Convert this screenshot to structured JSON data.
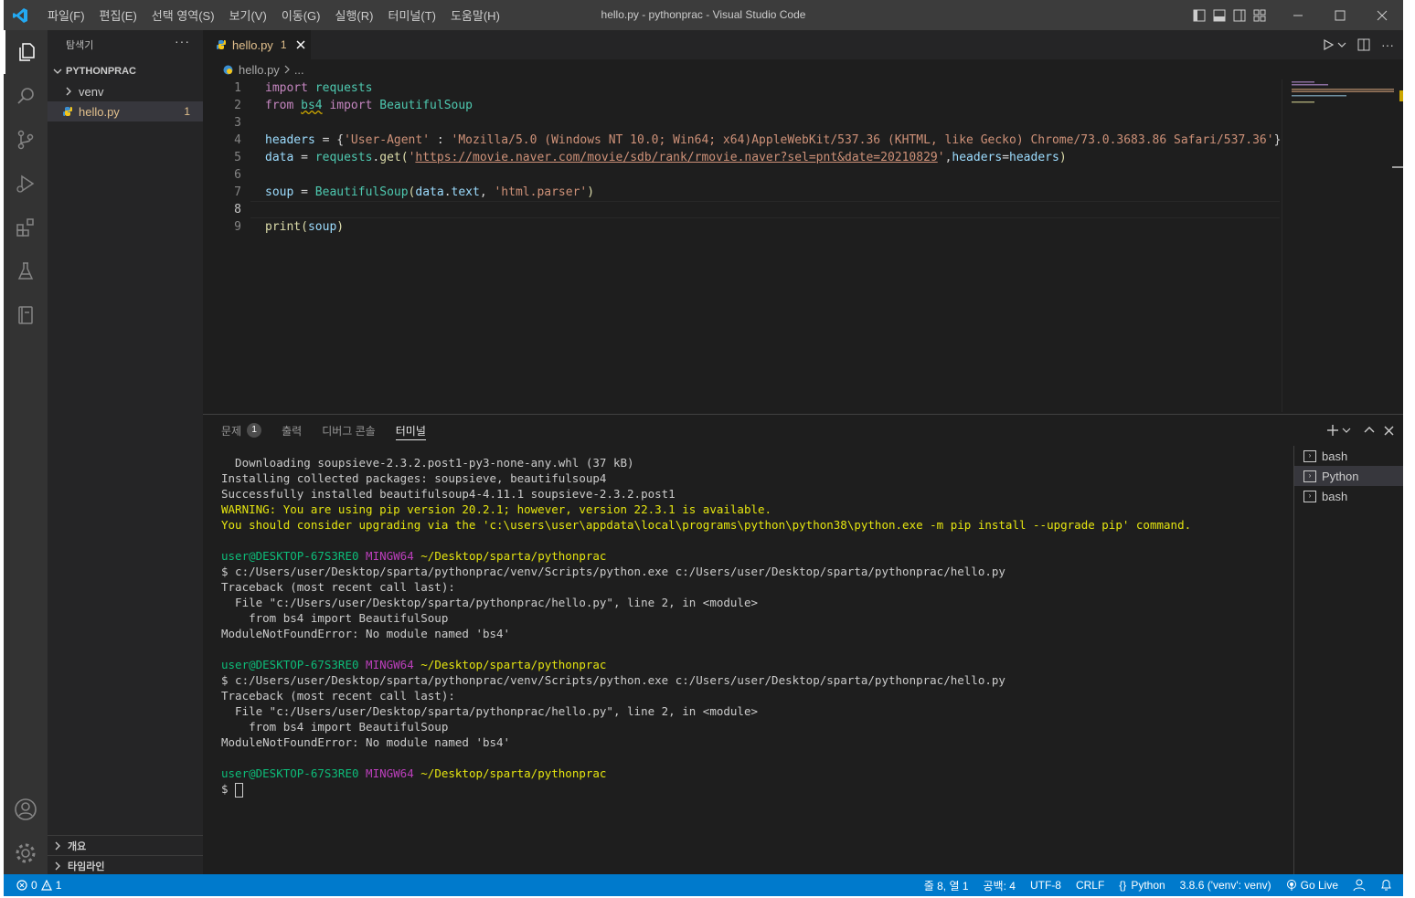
{
  "colors": {
    "accent": "#007acc",
    "editor_bg": "#1e1e1e",
    "sidebar_bg": "#252526",
    "activity_bg": "#333333",
    "title_bg": "#3c3c3c"
  },
  "menu": [
    "파일(F)",
    "편집(E)",
    "선택 영역(S)",
    "보기(V)",
    "이동(G)",
    "실행(R)",
    "터미널(T)",
    "도움말(H)"
  ],
  "window_title": "hello.py - pythonprac - Visual Studio Code",
  "sidebar": {
    "title": "탐색기",
    "more": "···",
    "folder": "PYTHONPRAC",
    "items": [
      {
        "label": "venv",
        "type": "folder"
      },
      {
        "label": "hello.py",
        "type": "file",
        "badge": "1"
      }
    ],
    "outline": "개요",
    "timeline": "타임라인"
  },
  "tab": {
    "label": "hello.py",
    "badge": "1"
  },
  "breadcrumb": {
    "file": "hello.py",
    "rest": "..."
  },
  "code": {
    "line_numbers": [
      "1",
      "2",
      "3",
      "4",
      "5",
      "6",
      "7",
      "8",
      "9"
    ],
    "l1": {
      "kw": "import",
      "mod": "requests"
    },
    "l2": {
      "kw1": "from",
      "mod1": "bs4",
      "kw2": "import",
      "mod2": "BeautifulSoup"
    },
    "l4": {
      "var": "headers",
      "eq": " = {",
      "key": "'User-Agent'",
      "colon": " : ",
      "val": "'Mozilla/5.0 (Windows NT 10.0; Win64; x64)AppleWebKit/537.36 (KHTML, like Gecko) Chrome/73.0.3683.86 Safari/537.36'",
      "close": "}"
    },
    "l5": {
      "var": "data",
      "eq": " = ",
      "mod": "requests",
      "dot": ".",
      "fn": "get",
      "open": "(",
      "q1": "'",
      "url": "https://movie.naver.com/movie/sdb/rank/rmovie.naver?sel=pnt&date=20210829",
      "q2": "'",
      "comma": ",",
      "arg": "headers",
      "eq2": "=",
      "arg2": "headers",
      "close": ")"
    },
    "l7": {
      "var": "soup",
      "eq": " = ",
      "cls": "BeautifulSoup",
      "open": "(",
      "a1": "data",
      "dot": ".",
      "a2": "text",
      "comma": ", ",
      "str": "'html.parser'",
      "close": ")"
    },
    "l9": {
      "fn": "print",
      "open": "(",
      "arg": "soup",
      "close": ")"
    }
  },
  "panel": {
    "tabs": [
      {
        "label": "문제",
        "badge": "1"
      },
      {
        "label": "출력"
      },
      {
        "label": "디버그 콘솔"
      },
      {
        "label": "터미널"
      }
    ],
    "terminal_list": [
      "bash",
      "Python",
      "bash"
    ]
  },
  "terminal": {
    "l1": "  Downloading soupsieve-2.3.2.post1-py3-none-any.whl (37 kB)",
    "l2": "Installing collected packages: soupsieve, beautifulsoup4",
    "l3": "Successfully installed beautifulsoup4-4.11.1 soupsieve-2.3.2.post1",
    "l4": "WARNING: You are using pip version 20.2.1; however, version 22.3.1 is available.",
    "l5": "You should consider upgrading via the 'c:\\users\\user\\appdata\\local\\programs\\python\\python38\\python.exe -m pip install --upgrade pip' command.",
    "user": "user@DESKTOP-67S3RE0",
    "host": "MINGW64",
    "path": "~/Desktop/sparta/pythonprac",
    "cmd": "$ c:/Users/user/Desktop/sparta/pythonprac/venv/Scripts/python.exe c:/Users/user/Desktop/sparta/pythonprac/hello.py",
    "tb": "Traceback (most recent call last):",
    "file": "  File \"c:/Users/user/Desktop/sparta/pythonprac/hello.py\", line 2, in <module>",
    "src": "    from bs4 import BeautifulSoup",
    "err": "ModuleNotFoundError: No module named 'bs4'",
    "prompt": "$ "
  },
  "status": {
    "errors": "0",
    "warnings": "1",
    "position": "줄 8, 열 1",
    "spaces": "공백: 4",
    "encoding": "UTF-8",
    "eol": "CRLF",
    "language": "Python",
    "interpreter": "3.8.6 ('venv': venv)",
    "golive": "Go Live"
  }
}
